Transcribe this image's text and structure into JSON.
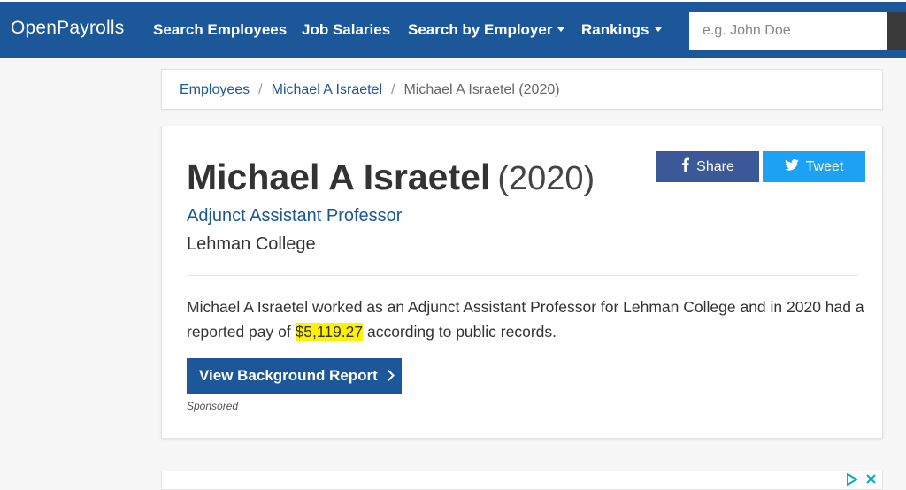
{
  "navbar": {
    "brand": "OpenPayrolls",
    "links": [
      {
        "label": "Search Employees"
      },
      {
        "label": "Job Salaries"
      },
      {
        "label": "Search by Employer"
      },
      {
        "label": "Rankings"
      }
    ],
    "search_placeholder": "e.g. John Doe",
    "bg_color": "#1c5799"
  },
  "breadcrumb": {
    "items": [
      "Employees",
      "Michael A Israetel",
      "Michael A Israetel (2020)"
    ],
    "separator": "/"
  },
  "profile": {
    "name": "Michael A Israetel",
    "year": "(2020)",
    "job_title": "Adjunct Assistant Professor",
    "employer": "Lehman College",
    "description_before": "Michael A Israetel worked as an Adjunct Assistant Professor for Lehman College and in 2020 had a reported pay of ",
    "pay": "$5,119.27",
    "description_after": " according to public records.",
    "report_button": "View Background Report",
    "sponsored": "Sponsored"
  },
  "social": {
    "share_label": "Share",
    "tweet_label": "Tweet",
    "facebook_color": "#3b5998",
    "twitter_color": "#1da1f2"
  }
}
